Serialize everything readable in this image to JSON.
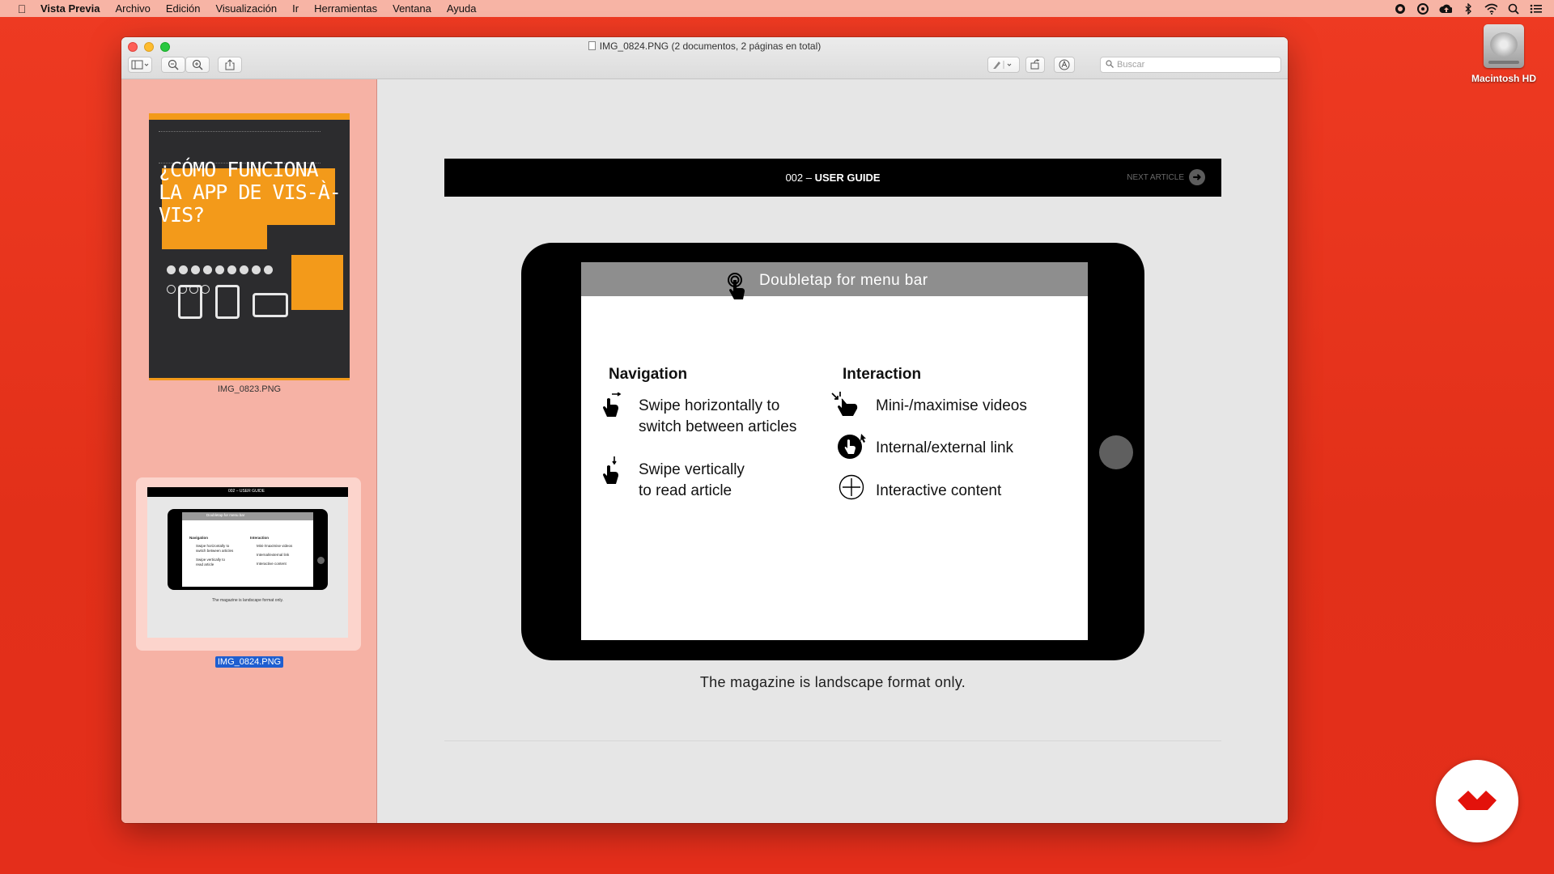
{
  "menubar": {
    "app": "Vista Previa",
    "items": [
      "Archivo",
      "Edición",
      "Visualización",
      "Ir",
      "Herramientas",
      "Ventana",
      "Ayuda"
    ]
  },
  "desktop": {
    "disk_label": "Macintosh HD"
  },
  "window": {
    "title": "IMG_0824.PNG (2 documentos, 2 páginas en total)",
    "search_placeholder": "Buscar"
  },
  "sidebar": {
    "thumbnails": [
      {
        "label": "IMG_0823.PNG",
        "headline": "¿CÓMO FUNCIONA LA APP DE VIS-À-VIS?",
        "selected": false
      },
      {
        "label": "IMG_0824.PNG",
        "selected": true
      }
    ]
  },
  "thumb2": {
    "header": "002 – USER GUIDE",
    "menu": "Doubletap for menu bar",
    "nav": "Navigation",
    "nav1": "Swipe horizontally to switch between articles",
    "nav2": "Swipe vertically to read article",
    "int": "Interaction",
    "int1": "Mini-/maximise videos",
    "int2": "Internal/external link",
    "int3": "Interactive content",
    "caption": "The magazine is landscape format only."
  },
  "page": {
    "header_num": "002 –",
    "header_title": "USER GUIDE",
    "next_label": "NEXT ARTICLE",
    "menu_hint": "Doubletap for menu bar",
    "navigation": {
      "heading": "Navigation",
      "items": [
        {
          "line1": "Swipe horizontally to",
          "line2": "switch between articles",
          "icon": "swipe-horizontal-icon"
        },
        {
          "line1": "Swipe vertically",
          "line2": "to read article",
          "icon": "swipe-vertical-icon"
        }
      ]
    },
    "interaction": {
      "heading": "Interaction",
      "items": [
        {
          "label": "Mini-/maximise videos",
          "icon": "pinch-icon"
        },
        {
          "label": "Internal/external link",
          "icon": "link-tap-icon"
        },
        {
          "label": "Interactive content",
          "icon": "plus-circle-icon"
        }
      ]
    },
    "caption": "The magazine is landscape format only."
  },
  "colors": {
    "desktop": "#e8321e",
    "menubar": "#f7b4a5",
    "sidebar": "#f6b2a5",
    "selection": "#1e5ed0",
    "accent_orange": "#f39a1a"
  }
}
